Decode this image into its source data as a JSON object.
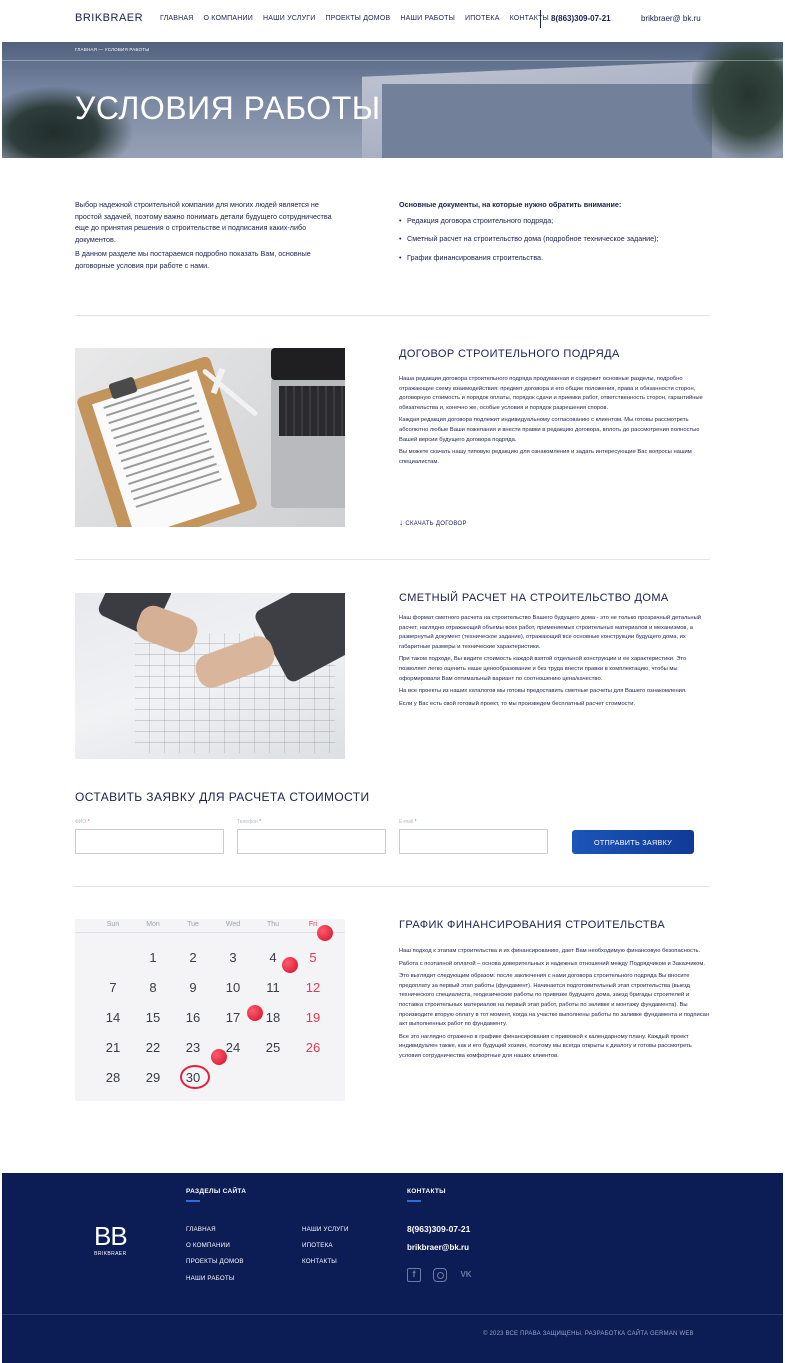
{
  "header": {
    "logo": "BRIKBRAER",
    "nav": [
      "ГЛАВНАЯ",
      "О КОМПАНИИ",
      "НАШИ УСЛУГИ",
      "ПРОЕКТЫ ДОМОВ",
      "НАШИ РАБОТЫ",
      "ИПОТЕКА",
      "КОНТАКТЫ"
    ],
    "phone": "8(863)309-07-21",
    "email": "brikbraer@ bk.ru"
  },
  "hero": {
    "breadcrumb": "ГЛАВНАЯ — УСЛОВИЯ РАБОТЫ",
    "title": "УСЛОВИЯ РАБОТЫ"
  },
  "intro": {
    "left_p1": "Выбор надежной строительной компании для многих людей является не простой задачей, поэтому важно понимать детали будущего сотрудничества еще до принятия решения о строительстве и подписания каких-либо документов.",
    "left_p2": "В данном разделе мы постараемся подробно показать Вам, основные договорные условия при работе с нами.",
    "right_heading": "Основные документы, на которые нужно обратить внимание:",
    "right_items": [
      "Редакция договора строительного подряда;",
      "Сметный расчет на строительство дома (подробное техническое задание);",
      "График финансирования строительства."
    ]
  },
  "contract": {
    "title": "ДОГОВОР СТРОИТЕЛЬНОГО ПОДРЯДА",
    "p1": "Наша редакция договора строительного подряда продуманная и содержит основные разделы, подробно отражающие схему взаимодействия: предмет договора и его общие положения, права и обязанности сторон, договорную стоимость и порядок оплаты, порядок сдачи и приемки работ, ответственность сторон, гарантийные обязательства и, конечно же, особые условия и порядок разрешения споров.",
    "p2": "Каждая редакция договора подлежит индивидуальному согласованию с клиентом. Мы готовы рассмотреть абсолютно любые Ваши пожелания и внести правки в редакцию договора, вплоть до рассмотрения полностью Вашей версии будущего договора подряда.",
    "p3": "Вы можете скачать нашу типовую редакцию для ознакомления и задать интересующие Вас вопросы нашим специалистам.",
    "download": "СКАЧАТЬ ДОГОВОР"
  },
  "estimate": {
    "title": "СМЕТНЫЙ РАСЧЕТ НА СТРОИТЕЛЬСТВО ДОМА",
    "p1": "Наш формат сметного расчета на строительство Вашего будущего дома - это не только прозрачный детальный расчет, наглядно отражающий объемы всех работ, применяемых строительных материалов и механизмов, а развернутый документ (техническое задание), отражающий все основные конструкции будущего дома, их габаритные размеры и технические характеристики.",
    "p2": "При таком подходе, Вы видите стоимость каждой взятой отдельной конструкции и ее характеристики. Это позволяет легко оценить наше ценообразование и без труда внести правки в комплектацию, чтобы мы оформировали Вам оптимальный вариант по соотношению цена/качество.",
    "p3": "На все проекты из наших каталогов мы готовы предоставить сметные расчеты для Вашего ознакомления.",
    "p4": "Если у Вас есть свой готовый проект, то мы произведем бесплатный расчет стоимости."
  },
  "form": {
    "title": "ОСТАВИТЬ ЗАЯВКУ ДЛЯ РАСЧЕТА СТОИМОСТИ",
    "name_label": "ФИО",
    "phone_label": "Телефон",
    "email_label": "E-mail",
    "required_mark": "*",
    "submit": "ОТПРАВИТЬ ЗАЯВКУ"
  },
  "schedule": {
    "title": "ГРАФИК ФИНАНСИРОВАНИЯ СТРОИТЕЛЬСТВА",
    "p1": "Наш подход к этапам строительства и их финансированию, дает Вам необходимую финансовую безопасность.",
    "p2": "Работа с поэтапной оплатой – основа доверительных и надежных отношений между Подрядчиком и Заказчиком.",
    "p3": "Это выглядит следующим образом: после заключения с нами договора строительного подряда Вы вносите предоплату за первый этап работы (фундамент). Начинается подготовительный этап строительства (выезд технического специалиста, геодезические работы по привязке будущего дома, заезд бригады строителей и поставка строительных материалов на первый этап работ, работы по заливке и монтажу фундамента). Вы производите вторую оплату в тот момент, когда на участке выполнены работы по заливке фундамента и подписан акт выполненных работ по фундаменту.",
    "p4": "Все это наглядно отражено в графике финансирования с привязкой к календарному плану. Каждый проект индивидуален также, как и его будущий хозяин, поэтому мы всегда открыты к диалогу и готовы рассмотреть условия сотрудничества комфортные для наших клиентов."
  },
  "calendar": {
    "days": [
      "Sun",
      "Mon",
      "Tue",
      "Wed",
      "Thu",
      "Fri"
    ],
    "rows": [
      [
        "",
        "1",
        "2",
        "3",
        "4",
        "5"
      ],
      [
        "7",
        "8",
        "9",
        "10",
        "11",
        "12"
      ],
      [
        "14",
        "15",
        "16",
        "17",
        "18",
        "19"
      ],
      [
        "21",
        "22",
        "23",
        "24",
        "25",
        "26"
      ],
      [
        "28",
        "29",
        "30",
        "",
        "",
        ""
      ]
    ]
  },
  "footer": {
    "logo_mark": "BB",
    "logo_name": "BRIKBRAER",
    "sections_heading": "РАЗДЕЛЫ САЙТА",
    "links_col1": [
      "ГЛАВНАЯ",
      "О КОМПАНИИ",
      "ПРОЕКТЫ ДОМОВ",
      "НАШИ РАБОТЫ"
    ],
    "links_col2": [
      "НАШИ УСЛУГИ",
      "ИПОТЕКА",
      "КОНТАКТЫ"
    ],
    "contacts_heading": "КОНТАКТЫ",
    "phone": "8(963)309-07-21",
    "email": "brikbraer@bk.ru",
    "social": [
      "facebook-icon",
      "instagram-icon",
      "vk-icon"
    ],
    "copyright": "2023 ВСЕ ПРАВА ЗАЩИЩЕНЫ. РАЗРАБОТКА САЙТА GERMAN  WEB"
  },
  "colors": {
    "brand_navy": "#0c1d55",
    "accent_blue": "#1c56b8",
    "required_red": "#e24a5b"
  }
}
